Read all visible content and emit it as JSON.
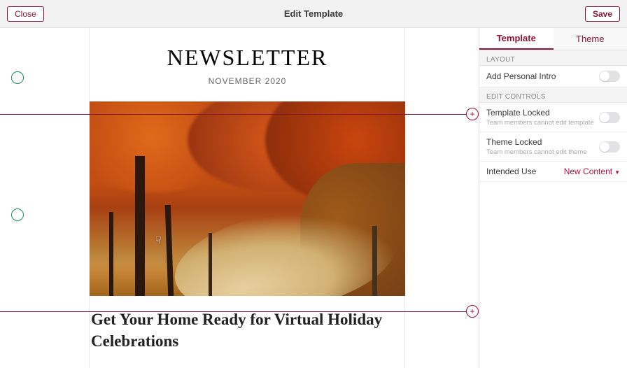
{
  "topbar": {
    "close": "Close",
    "title": "Edit Template",
    "save": "Save"
  },
  "sidebar": {
    "tabs": {
      "template": "Template",
      "theme": "Theme"
    },
    "layout_section": "Layout",
    "add_personal_intro": "Add Personal Intro",
    "edit_controls_section": "Edit Controls",
    "template_locked": {
      "label": "Template Locked",
      "sub": "Team members cannot edit template"
    },
    "theme_locked": {
      "label": "Theme Locked",
      "sub": "Team members cannot edit theme"
    },
    "intended_use": {
      "label": "Intended Use",
      "value": "New Content"
    }
  },
  "newsletter": {
    "heading": "NEWSLETTER",
    "date": "NOVEMBER 2020",
    "article_title": "Get Your Home Ready for Virtual Holiday Celebrations"
  }
}
